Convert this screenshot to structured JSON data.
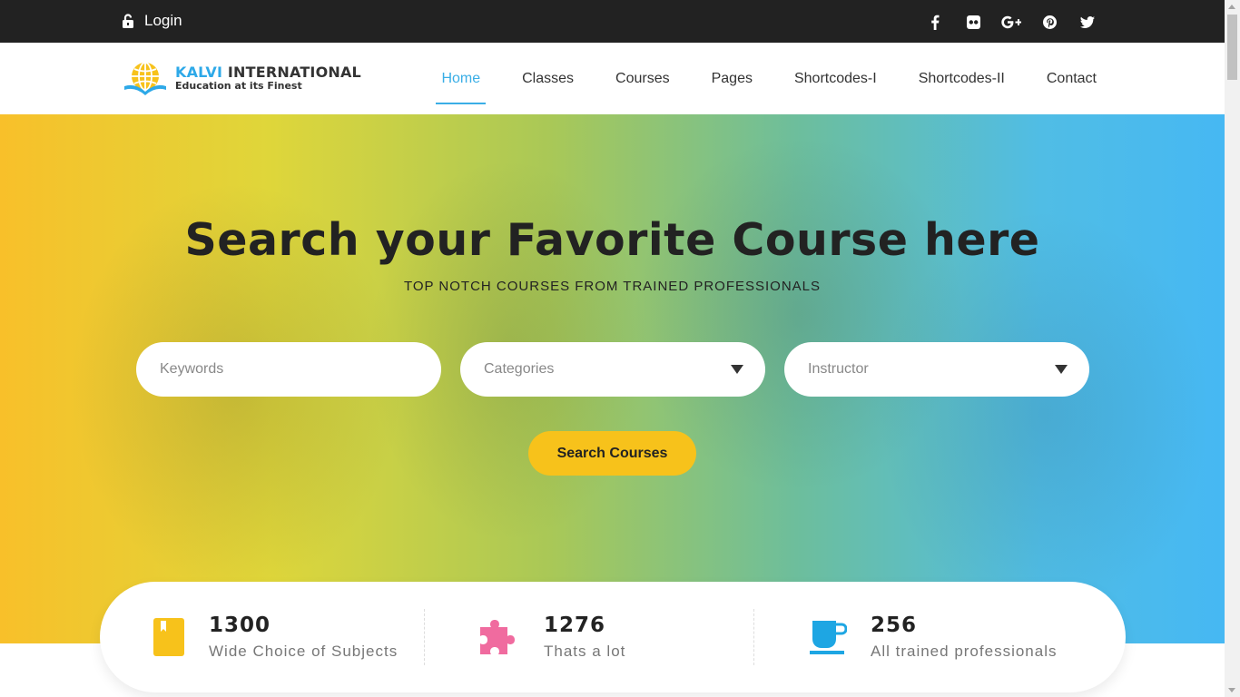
{
  "topbar": {
    "login_label": "Login",
    "social": [
      "facebook-icon",
      "flickr-icon",
      "google-plus-icon",
      "pinterest-icon",
      "twitter-icon"
    ]
  },
  "brand": {
    "name_first": "KALVI",
    "name_rest": " INTERNATIONAL",
    "tagline": "Education at its Finest"
  },
  "nav": {
    "items": [
      {
        "label": "Home",
        "active": true
      },
      {
        "label": "Classes"
      },
      {
        "label": "Courses"
      },
      {
        "label": "Pages"
      },
      {
        "label": "Shortcodes-I"
      },
      {
        "label": "Shortcodes-II"
      },
      {
        "label": "Contact"
      }
    ]
  },
  "hero": {
    "title": "Search your Favorite Course here",
    "subtitle": "TOP NOTCH COURSES FROM TRAINED PROFESSIONALS",
    "keywords_placeholder": "Keywords",
    "categories_label": "Categories",
    "instructor_label": "Instructor",
    "search_button": "Search Courses"
  },
  "stats": [
    {
      "number": "1300",
      "label": "Wide Choice of Subjects",
      "icon": "book-icon",
      "color": "#f7c21b"
    },
    {
      "number": "1276",
      "label": "Thats a lot",
      "icon": "puzzle-icon",
      "color": "#f06b9f"
    },
    {
      "number": "256",
      "label": "All trained professionals",
      "icon": "coffee-cup-icon",
      "color": "#1ea6e3"
    }
  ],
  "colors": {
    "accent": "#3aaee6",
    "button": "#f7c21b",
    "topbar": "#222222"
  }
}
